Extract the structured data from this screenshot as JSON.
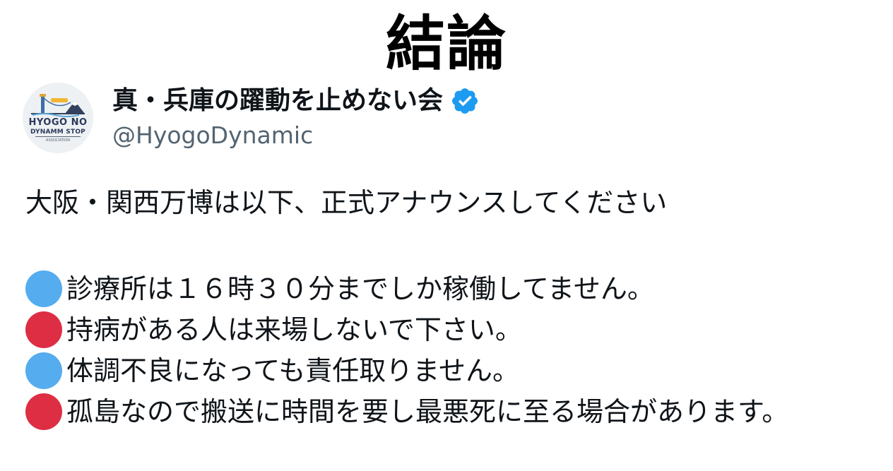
{
  "headline": "結論",
  "tweet": {
    "display_name": "真・兵庫の躍動を止めない会",
    "verified_icon": "verified-badge-icon",
    "handle": "@HyogoDynamic",
    "avatar": {
      "line1": "HYOGO NO",
      "line2": "DYNAMM STOP",
      "line3": "ASSOCIATION"
    },
    "intro": "大阪・関西万博は以下、正式アナウンスしてください",
    "bullets": [
      {
        "color": "blue",
        "text": "診療所は１６時３０分までしか稼働してません。"
      },
      {
        "color": "red",
        "text": "持病がある人は来場しないで下さい。"
      },
      {
        "color": "blue",
        "text": "体調不良になっても責任取りません。"
      },
      {
        "color": "red",
        "text": "孤島なので搬送に時間を要し最悪死に至る場合があります。"
      }
    ]
  },
  "colors": {
    "blue_circle": "#55acee",
    "red_circle": "#dd2e44",
    "verified_blue": "#1d9bf0",
    "handle_gray": "#536471"
  }
}
